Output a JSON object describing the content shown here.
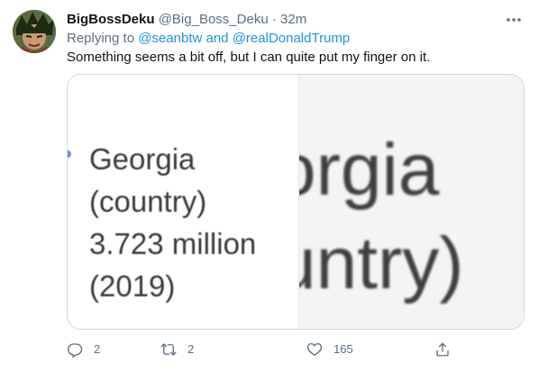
{
  "user": {
    "display_name": "BigBossDeku",
    "handle": "@Big_Boss_Deku",
    "separator": "·",
    "time": "32m"
  },
  "reply": {
    "prefix": "Replying to",
    "mention1": "@seanbtw",
    "joiner": "and",
    "mention2": "@realDonaldTrump"
  },
  "body": "Something seems a bit off, but I can quite put my finger on it.",
  "media": {
    "left_lines": [
      "Georgia",
      "(country)",
      "3.723 million",
      "(2019)"
    ],
    "right_lines": [
      "orgia",
      "untry)"
    ]
  },
  "actions": {
    "reply_count": "2",
    "retweet_count": "2",
    "like_count": "165"
  },
  "colors": {
    "mention": "#1b95e0",
    "muted": "#5b7083",
    "text": "#0f1419"
  }
}
